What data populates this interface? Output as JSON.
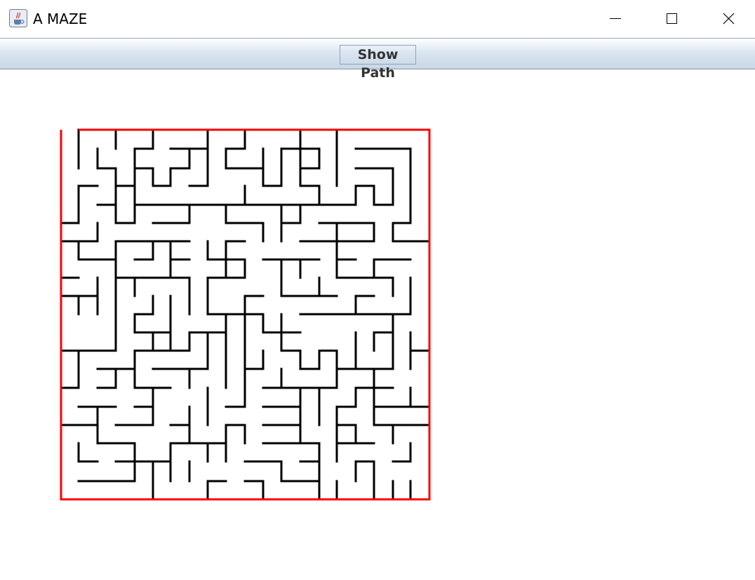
{
  "window": {
    "title": "A MAZE",
    "icon": "java-cup-icon",
    "controls": [
      "minimize-icon",
      "maximize-icon",
      "close-icon"
    ]
  },
  "toolbar": {
    "show_path_label": "Show Path"
  },
  "maze": {
    "wall_color": "#000000",
    "border_color": "#ff0000",
    "grid_columns": 20,
    "grid_rows": 20
  }
}
